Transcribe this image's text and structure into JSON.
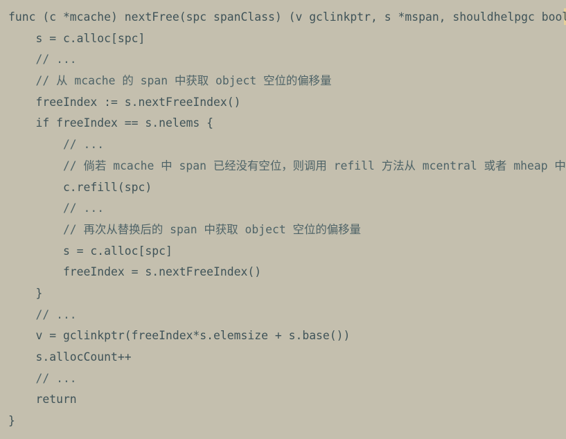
{
  "code": {
    "language": "go",
    "lines": [
      "func (c *mcache) nextFree(spc spanClass) (v gclinkptr, s *mspan, shouldhelpgc bool) {",
      "    s = c.alloc[spc]",
      "    // ...",
      "    // 从 mcache 的 span 中获取 object 空位的偏移量",
      "    freeIndex := s.nextFreeIndex()",
      "    if freeIndex == s.nelems {",
      "        // ...",
      "        // 倘若 mcache 中 span 已经没有空位，则调用 refill 方法从 mcentral 或者 mheap 中获取新的 span",
      "        c.refill(spc)",
      "        // ...",
      "        // 再次从替换后的 span 中获取 object 空位的偏移量",
      "        s = c.alloc[spc]",
      "        freeIndex = s.nextFreeIndex()",
      "    }",
      "    // ...",
      "    v = gclinkptr(freeIndex*s.elemsize + s.base())",
      "    s.allocCount++",
      "    // ...",
      "    return",
      "}"
    ]
  }
}
